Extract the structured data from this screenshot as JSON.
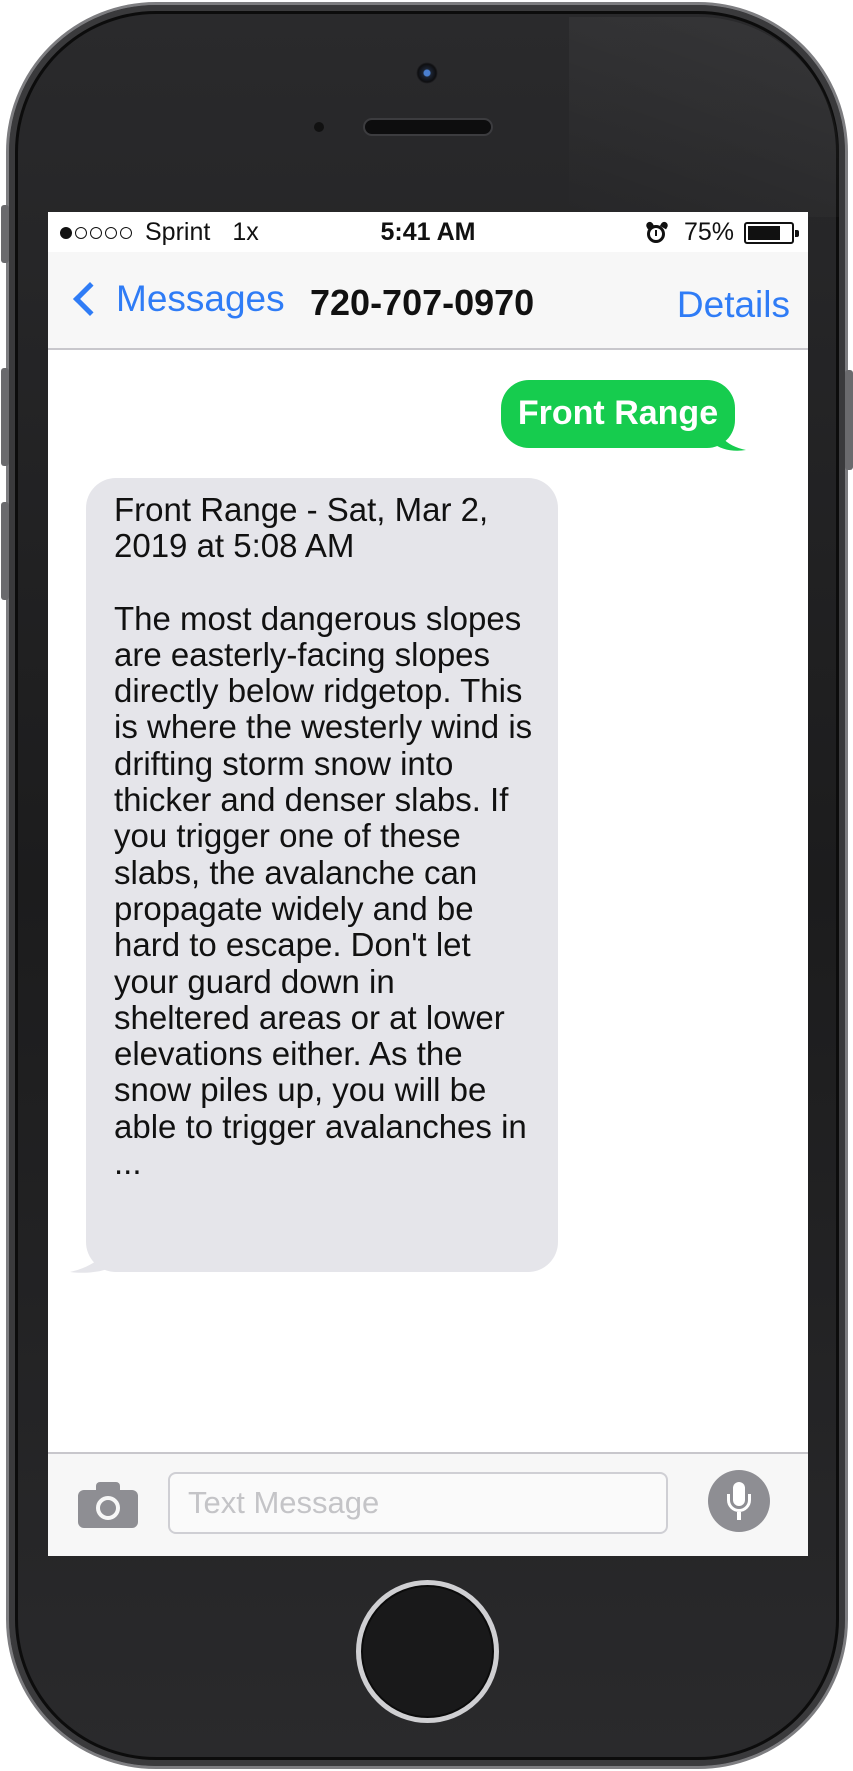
{
  "status_bar": {
    "signal_dots": [
      true,
      false,
      false,
      false,
      false
    ],
    "carrier": "Sprint",
    "network": "1x",
    "time": "5:41 AM",
    "alarm_icon": "alarm-clock-icon",
    "battery_percent": "75%",
    "battery_level": 0.75
  },
  "nav": {
    "back_label": "Messages",
    "back_icon": "chevron-left-icon",
    "title": "720-707-0970",
    "details_label": "Details"
  },
  "messages": {
    "outgoing": {
      "text": "Front Range",
      "color": "#16cc4e"
    },
    "incoming": {
      "header": "Front Range - Sat, Mar 2, 2019 at 5:08 AM",
      "body": "The most dangerous slopes are easterly-facing slopes directly below ridgetop. This is where the westerly wind is drifting storm snow into thicker and denser slabs. If you trigger one of these slabs, the avalanche can propagate widely and be hard to escape. Don't let your guard down in sheltered areas or at lower elevations either. As the snow piles up, you will be able to trigger avalanches in ...",
      "color": "#e5e5ea"
    }
  },
  "input_bar": {
    "camera_icon": "camera-icon",
    "placeholder": "Text Message",
    "value": "",
    "mic_icon": "microphone-icon"
  },
  "colors": {
    "accent": "#2f7cf6",
    "phone_body": "#1c1c1d"
  }
}
